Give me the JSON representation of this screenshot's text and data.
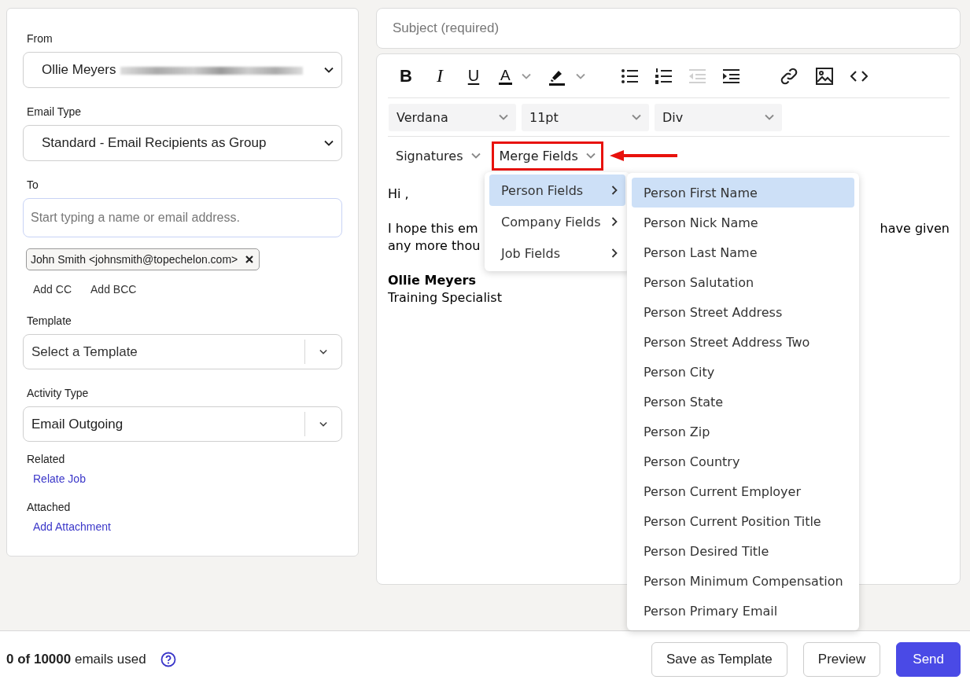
{
  "sender": {
    "label": "From",
    "value": "Ollie Meyers"
  },
  "email_type": {
    "label": "Email Type",
    "value": "Standard - Email Recipients as Group"
  },
  "to": {
    "label": "To",
    "placeholder": "Start typing a name or email address."
  },
  "recipients": [
    {
      "text": "John Smith <johnsmith@topechelon.com>"
    }
  ],
  "cc_links": [
    "Add CC",
    "Add BCC"
  ],
  "template": {
    "label": "Template",
    "placeholder": "Select a Template"
  },
  "activity_type": {
    "label": "Activity Type",
    "value": "Email Outgoing"
  },
  "related": {
    "label": "Related",
    "link": "Relate Job"
  },
  "attached": {
    "label": "Attached",
    "link": "Add Attachment"
  },
  "subject": {
    "placeholder": "Subject (required)"
  },
  "toolbar": [
    {
      "kind": "bold",
      "text": "B",
      "disabled": false
    },
    {
      "kind": "italic",
      "text": "I",
      "disabled": false
    },
    {
      "kind": "underline",
      "text": "U",
      "disabled": false
    },
    {
      "kind": "text-color",
      "text": "A",
      "disabled": false
    },
    {
      "kind": "highlight",
      "disabled": false
    },
    {
      "kind": "bullets",
      "disabled": false
    },
    {
      "kind": "numbers",
      "disabled": false
    },
    {
      "kind": "outdent",
      "disabled": true
    },
    {
      "kind": "indent",
      "disabled": false
    },
    {
      "kind": "link",
      "disabled": false
    },
    {
      "kind": "image",
      "disabled": false
    },
    {
      "kind": "code",
      "disabled": false
    }
  ],
  "format_selects": [
    {
      "value": "Verdana"
    },
    {
      "value": "11pt"
    },
    {
      "value": "Div"
    }
  ],
  "insert_menus": [
    {
      "label": "Signatures",
      "highlighted": false
    },
    {
      "label": "Merge Fields",
      "highlighted": true
    }
  ],
  "body": {
    "greeting": "Hi ,",
    "line1_left": "I hope this em",
    "line1_right": "have given",
    "line2": "any more thou",
    "signature_name": "Ollie Meyers",
    "signature_title": "Training Specialist"
  },
  "merge_menu": [
    {
      "label": "Person Fields",
      "selected": true
    },
    {
      "label": "Company Fields",
      "selected": false
    },
    {
      "label": "Job Fields",
      "selected": false
    }
  ],
  "submenu": [
    {
      "label": "Person First Name",
      "selected": true
    },
    {
      "label": "Person Nick Name",
      "selected": false
    },
    {
      "label": "Person Last Name",
      "selected": false
    },
    {
      "label": "Person Salutation",
      "selected": false
    },
    {
      "label": "Person Street Address",
      "selected": false
    },
    {
      "label": "Person Street Address Two",
      "selected": false
    },
    {
      "label": "Person City",
      "selected": false
    },
    {
      "label": "Person State",
      "selected": false
    },
    {
      "label": "Person Zip",
      "selected": false
    },
    {
      "label": "Person Country",
      "selected": false
    },
    {
      "label": "Person Current Employer",
      "selected": false
    },
    {
      "label": "Person Current Position Title",
      "selected": false
    },
    {
      "label": "Person Desired Title",
      "selected": false
    },
    {
      "label": "Person Minimum Compensation",
      "selected": false
    },
    {
      "label": "Person Primary Email",
      "selected": false
    }
  ],
  "footer": {
    "usage": "**0 of 10000** emails used",
    "buttons": [
      {
        "label": "Save as Template",
        "kind": "secondary"
      },
      {
        "label": "Preview",
        "kind": "secondary"
      },
      {
        "label": "Send",
        "kind": "primary"
      }
    ]
  }
}
